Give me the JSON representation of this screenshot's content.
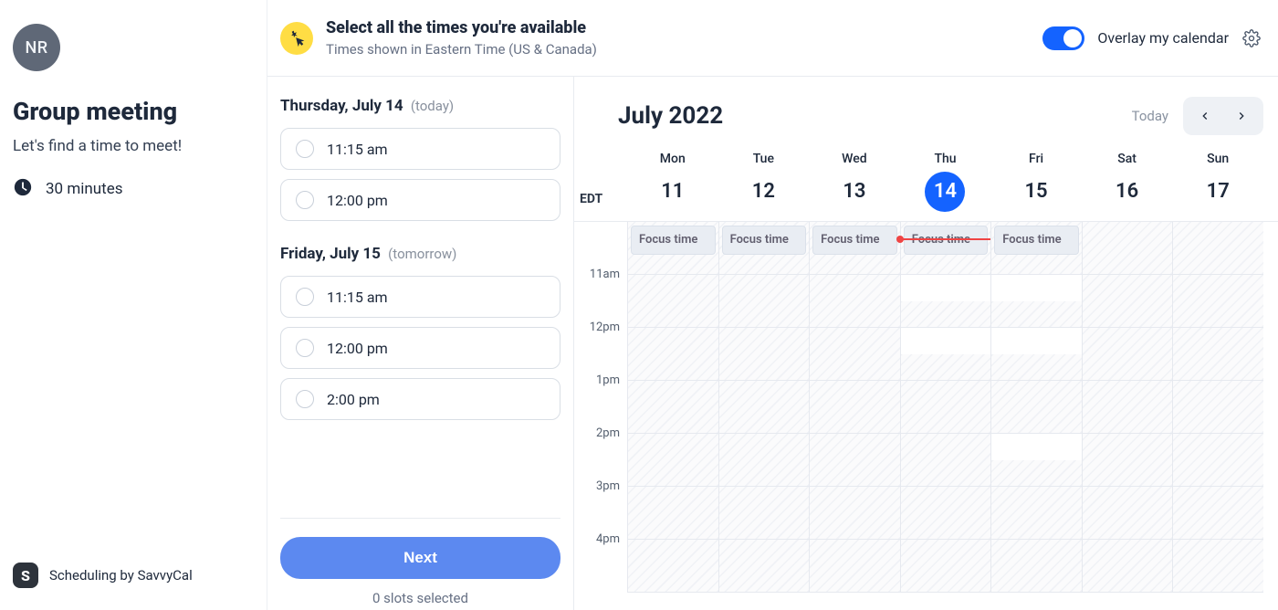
{
  "sidebar": {
    "avatar_initials": "NR",
    "meeting_title": "Group meeting",
    "meeting_subtitle": "Let's find a time to meet!",
    "duration": "30 minutes",
    "footer": "Scheduling by SavvyCal",
    "footer_logo": "S"
  },
  "banner": {
    "title": "Select all the times you're available",
    "subtitle": "Times shown in Eastern Time (US & Canada)",
    "overlay_label": "Overlay my calendar",
    "overlay_enabled": true
  },
  "slots": {
    "days": [
      {
        "label": "Thursday, July 14",
        "meta": "(today)",
        "times": [
          "11:15 am",
          "12:00 pm"
        ]
      },
      {
        "label": "Friday, July 15",
        "meta": "(tomorrow)",
        "times": [
          "11:15 am",
          "12:00 pm",
          "2:00 pm"
        ]
      }
    ],
    "next_label": "Next",
    "selected_count": "0 slots selected"
  },
  "calendar": {
    "month_label": "July 2022",
    "today_label": "Today",
    "tz": "EDT",
    "days": [
      {
        "dow": "Mon",
        "dom": "11",
        "today": false
      },
      {
        "dow": "Tue",
        "dom": "12",
        "today": false
      },
      {
        "dow": "Wed",
        "dom": "13",
        "today": false
      },
      {
        "dow": "Thu",
        "dom": "14",
        "today": true
      },
      {
        "dow": "Fri",
        "dom": "15",
        "today": false
      },
      {
        "dow": "Sat",
        "dom": "16",
        "today": false
      },
      {
        "dow": "Sun",
        "dom": "17",
        "today": false
      }
    ],
    "hours": [
      "",
      "11am",
      "12pm",
      "1pm",
      "2pm",
      "3pm",
      "4pm"
    ],
    "focus_label": "Focus time",
    "focus_columns": [
      0,
      1,
      2,
      3,
      4
    ],
    "now_row": 0,
    "open_slots": [
      {
        "row": 1,
        "col": 3,
        "half": "top"
      },
      {
        "row": 2,
        "col": 3,
        "half": "top"
      },
      {
        "row": 1,
        "col": 4,
        "half": "top"
      },
      {
        "row": 2,
        "col": 4,
        "half": "top"
      },
      {
        "row": 4,
        "col": 4,
        "half": "top"
      }
    ]
  }
}
